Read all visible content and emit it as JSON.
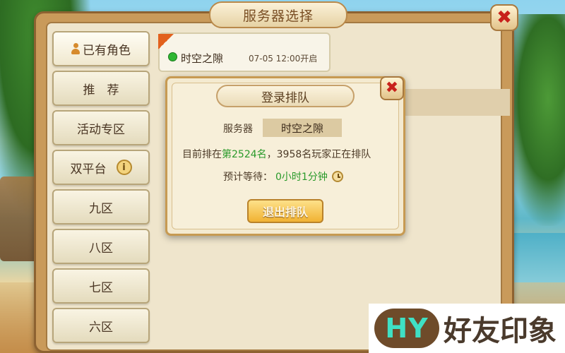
{
  "window": {
    "title": "服务器选择",
    "close_symbol": "✖"
  },
  "sidebar": {
    "items": [
      {
        "label": "已有角色",
        "icon": "person-icon"
      },
      {
        "label": "推　荐"
      },
      {
        "label": "活动专区"
      },
      {
        "label": "双平台",
        "icon": "info-icon",
        "icon_glyph": "i"
      },
      {
        "label": "九区"
      },
      {
        "label": "八区"
      },
      {
        "label": "七区"
      },
      {
        "label": "六区"
      }
    ]
  },
  "server_list": {
    "server": {
      "name": "时空之隙",
      "open_time": "07-05 12:00开启",
      "status_color": "#2fb632"
    }
  },
  "queue_dialog": {
    "title": "登录排队",
    "close_symbol": "✖",
    "server_label": "服务器",
    "server_value": "时空之隙",
    "rank_prefix": "目前排在",
    "rank_value": "第2524名",
    "rank_suffix": "，3958名玩家正在排队",
    "wait_label": "预计等待：",
    "wait_value": "0小时1分钟",
    "exit_button": "退出排队"
  },
  "watermark": {
    "logo": "HY",
    "text": "好友印象"
  }
}
